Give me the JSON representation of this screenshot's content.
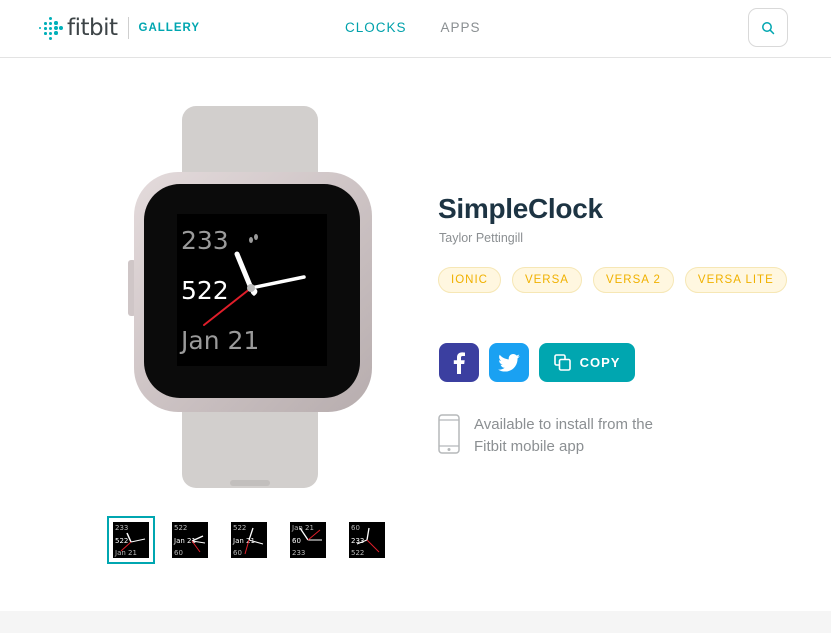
{
  "header": {
    "brand": "fitbit",
    "section": "GALLERY",
    "nav": [
      {
        "label": "CLOCKS",
        "active": true
      },
      {
        "label": "APPS",
        "active": false
      }
    ],
    "search_icon": "search-icon"
  },
  "watch": {
    "screen": {
      "line1": "233",
      "line2": "522",
      "line3": "Jan 21"
    }
  },
  "thumbnails": [
    {
      "lines": [
        "233",
        "522",
        "Jan 21"
      ],
      "selected": true
    },
    {
      "lines": [
        "522",
        "Jan 21",
        "60"
      ],
      "selected": false
    },
    {
      "lines": [
        "522",
        "Jan 21",
        "60"
      ],
      "selected": false
    },
    {
      "lines": [
        "Jan 21",
        "60",
        "233"
      ],
      "selected": false
    },
    {
      "lines": [
        "60",
        "233",
        "522"
      ],
      "selected": false
    }
  ],
  "app": {
    "title": "SimpleClock",
    "author": "Taylor Pettingill",
    "devices": [
      "IONIC",
      "VERSA",
      "VERSA 2",
      "VERSA LITE"
    ]
  },
  "share": {
    "facebook_icon": "facebook-icon",
    "twitter_icon": "twitter-icon",
    "copy_label": "COPY"
  },
  "install": {
    "text": "Available to install from the Fitbit mobile app"
  },
  "colors": {
    "accent": "#00a6b0",
    "tag_text": "#f0b100",
    "facebook": "#3b3fa0",
    "twitter": "#1aa1f2"
  }
}
